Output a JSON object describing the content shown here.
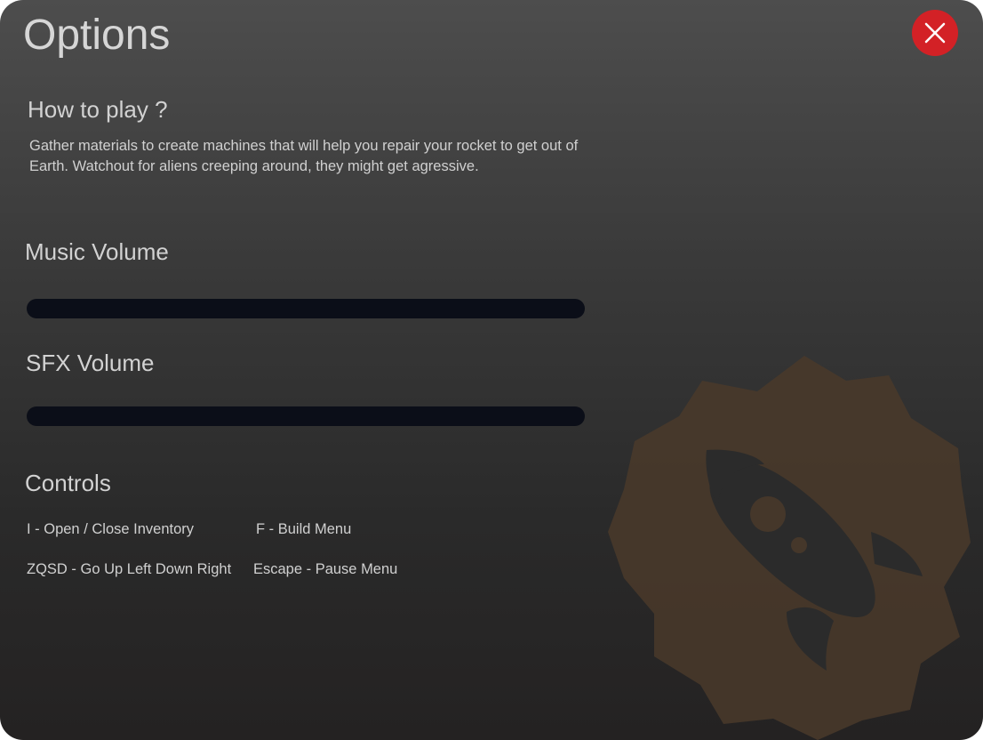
{
  "window": {
    "title": "Options"
  },
  "close_button": {
    "icon": "close-icon",
    "color": "#d32126"
  },
  "how_to_play": {
    "heading": "How to play ?",
    "text": "Gather materials to create machines that will help you repair your rocket to get out of Earth. Watchout for aliens creeping around, they might get agressive."
  },
  "music_volume": {
    "label": "Music Volume",
    "value": 0
  },
  "sfx_volume": {
    "label": "SFX Volume",
    "value": 0
  },
  "controls": {
    "heading": "Controls",
    "items": [
      "I - Open / Close Inventory",
      "F - Build Menu",
      "ZQSD - Go Up Left Down Right",
      "Escape - Pause Menu"
    ]
  },
  "decoration": {
    "icon": "rocket-gear-emblem-icon",
    "gear_color": "#4a3a2a",
    "rocket_color": "#2b2b2b"
  }
}
